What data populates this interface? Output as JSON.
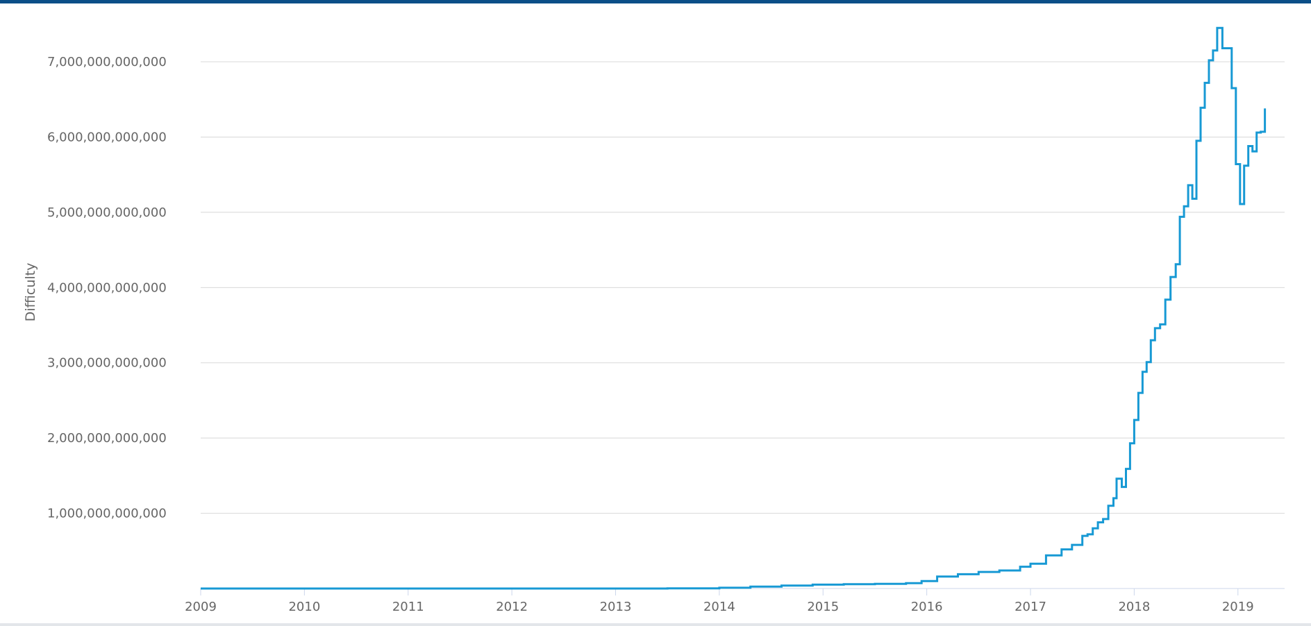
{
  "chart_data": {
    "type": "line",
    "title": "",
    "xlabel": "",
    "ylabel": "Difficulty",
    "xlim": [
      2009.0,
      2019.45
    ],
    "ylim": [
      0,
      7600000000000
    ],
    "grid": true,
    "colors": {
      "line": "#1799d4",
      "grid": "#d8d8d8",
      "axis": "#ccd6eb",
      "top_bar": "#0b4f88"
    },
    "x_ticks": [
      {
        "value": 2009,
        "label": "2009"
      },
      {
        "value": 2010,
        "label": "2010"
      },
      {
        "value": 2011,
        "label": "2011"
      },
      {
        "value": 2012,
        "label": "2012"
      },
      {
        "value": 2013,
        "label": "2013"
      },
      {
        "value": 2014,
        "label": "2014"
      },
      {
        "value": 2015,
        "label": "2015"
      },
      {
        "value": 2016,
        "label": "2016"
      },
      {
        "value": 2017,
        "label": "2017"
      },
      {
        "value": 2018,
        "label": "2018"
      },
      {
        "value": 2019,
        "label": "2019"
      }
    ],
    "y_ticks": [
      {
        "value": 1000000000000,
        "label": "1,000,000,000,000"
      },
      {
        "value": 2000000000000,
        "label": "2,000,000,000,000"
      },
      {
        "value": 3000000000000,
        "label": "3,000,000,000,000"
      },
      {
        "value": 4000000000000,
        "label": "4,000,000,000,000"
      },
      {
        "value": 5000000000000,
        "label": "5,000,000,000,000"
      },
      {
        "value": 6000000000000,
        "label": "6,000,000,000,000"
      },
      {
        "value": 7000000000000,
        "label": "7,000,000,000,000"
      }
    ],
    "series": [
      {
        "x": [
          2009.0,
          2013.5,
          2014.0,
          2014.3,
          2014.6,
          2014.9,
          2015.2,
          2015.5,
          2015.8,
          2015.95,
          2016.1,
          2016.3,
          2016.5,
          2016.7,
          2016.9,
          2017.0,
          2017.15,
          2017.3,
          2017.4,
          2017.5,
          2017.55,
          2017.6,
          2017.65,
          2017.7,
          2017.75,
          2017.8,
          2017.83,
          2017.88,
          2017.92,
          2017.96,
          2018.0,
          2018.04,
          2018.08,
          2018.12,
          2018.16,
          2018.2,
          2018.25,
          2018.3,
          2018.35,
          2018.4,
          2018.44,
          2018.48,
          2018.52,
          2018.56,
          2018.6,
          2018.64,
          2018.68,
          2018.72,
          2018.76,
          2018.8,
          2018.85,
          2018.9,
          2018.94,
          2018.98,
          2019.02,
          2019.06,
          2019.1,
          2019.14,
          2019.18,
          2019.22,
          2019.26
        ],
        "y": [
          0,
          3000000000,
          10000000000,
          25000000000,
          40000000000,
          52000000000,
          58000000000,
          62000000000,
          72000000000,
          100000000000,
          160000000000,
          190000000000,
          220000000000,
          240000000000,
          290000000000,
          330000000000,
          440000000000,
          520000000000,
          580000000000,
          700000000000,
          720000000000,
          800000000000,
          880000000000,
          923000000000,
          1100000000000,
          1200000000000,
          1460000000000,
          1350000000000,
          1590000000000,
          1930000000000,
          2240000000000,
          2600000000000,
          2880000000000,
          3010000000000,
          3300000000000,
          3460000000000,
          3510000000000,
          3840000000000,
          4140000000000,
          4310000000000,
          4940000000000,
          5080000000000,
          5360000000000,
          5180000000000,
          5950000000000,
          6390000000000,
          6720000000000,
          7020000000000,
          7150000000000,
          7450000000000,
          7180000000000,
          7180000000000,
          6650000000000,
          5640000000000,
          5110000000000,
          5620000000000,
          5880000000000,
          5810000000000,
          6060000000000,
          6070000000000,
          6380000000000
        ]
      }
    ]
  }
}
